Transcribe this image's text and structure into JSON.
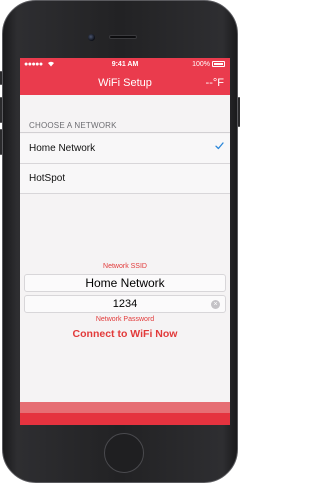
{
  "status_bar": {
    "signal": "●●●●●",
    "wifi_icon": "wifi-icon",
    "time": "9:41 AM",
    "battery": "100%"
  },
  "nav": {
    "title": "WiFi Setup",
    "temperature": "--°F"
  },
  "section": {
    "header": "CHOOSE A NETWORK"
  },
  "networks": [
    {
      "name": "Home Network",
      "selected": true
    },
    {
      "name": "HotSpot",
      "selected": false
    }
  ],
  "form": {
    "ssid_caption": "Network SSID",
    "ssid_value": "Home Network",
    "password_value": "1234",
    "password_caption": "Network Password",
    "connect_label": "Connect to WiFi Now"
  },
  "colors": {
    "accent": "#ea3b4d",
    "caption_red": "#e23a3a",
    "check_blue": "#2a86d9"
  }
}
